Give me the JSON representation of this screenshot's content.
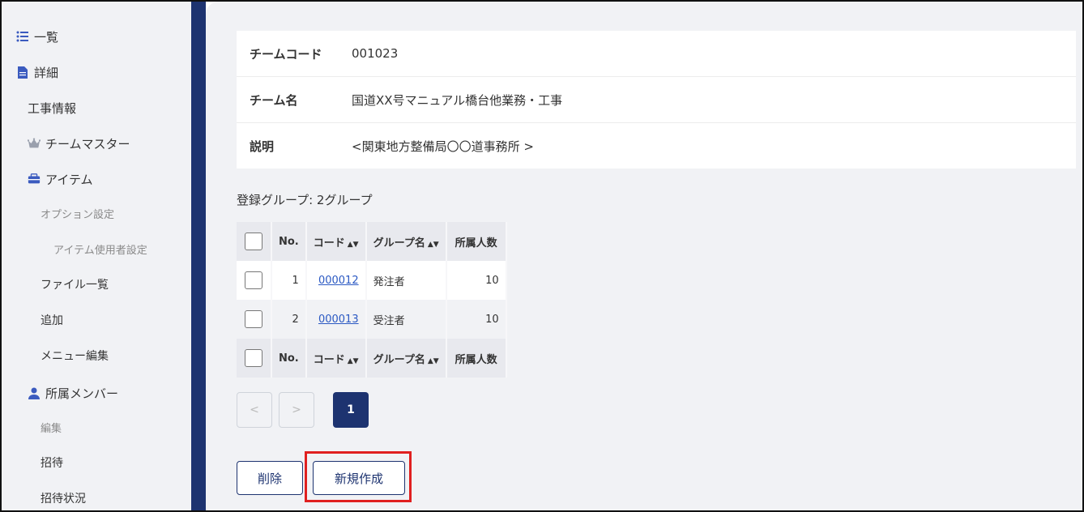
{
  "sidebar": {
    "list": "一覧",
    "detail": "詳細",
    "construction_info": "工事情報",
    "team_master": "チームマスター",
    "item": "アイテム",
    "option_settings": "オプション設定",
    "item_user_settings": "アイテム使用者設定",
    "file_list": "ファイル一覧",
    "add": "追加",
    "menu_edit": "メニュー編集",
    "members": "所属メンバー",
    "edit": "編集",
    "invite": "招待",
    "invite_status": "招待状況"
  },
  "team": {
    "code_label": "チームコード",
    "code_value": "001023",
    "name_label": "チーム名",
    "name_value": "国道XX号マニュアル橋台他業務・工事",
    "desc_label": "説明",
    "desc_value": "<関東地方整備局〇〇道事務所 >"
  },
  "groups": {
    "count_text": "登録グループ: 2グループ",
    "headers": {
      "no": "No.",
      "code": "コード",
      "name": "グループ名",
      "members": "所属人数"
    },
    "rows": [
      {
        "no": "1",
        "code": "000012",
        "name": "発注者",
        "members": "10"
      },
      {
        "no": "2",
        "code": "000013",
        "name": "受注者",
        "members": "10"
      }
    ]
  },
  "pagination": {
    "prev": "<",
    "next": ">",
    "current": "1"
  },
  "actions": {
    "delete": "削除",
    "create": "新規作成"
  },
  "colors": {
    "navy": "#1d3370",
    "link": "#2b59c3",
    "highlight": "#e02020"
  }
}
